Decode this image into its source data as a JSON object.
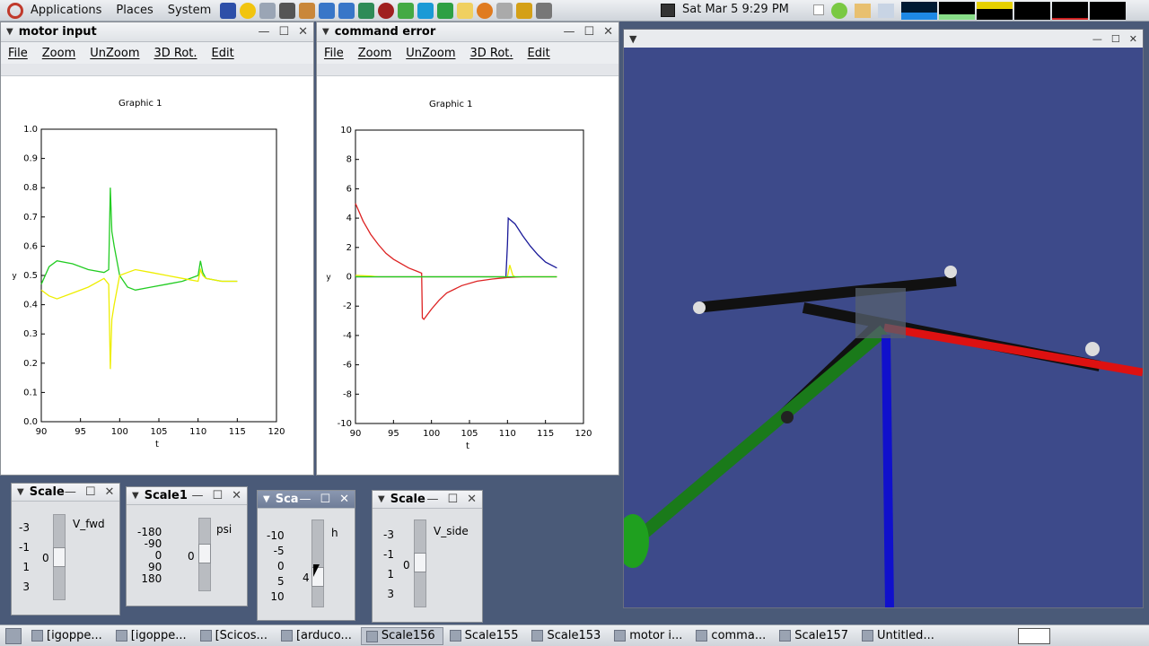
{
  "top_panel": {
    "menus": [
      "Applications",
      "Places",
      "System"
    ],
    "clock": "Sat Mar  5  9:29 PM"
  },
  "windows": {
    "motor_input": {
      "title": "motor input",
      "menu": [
        "File",
        "Zoom",
        "UnZoom",
        "3D Rot.",
        "Edit"
      ],
      "graphic_title": "Graphic 1"
    },
    "command_error": {
      "title": "command error",
      "menu": [
        "File",
        "Zoom",
        "UnZoom",
        "3D Rot.",
        "Edit"
      ],
      "graphic_title": "Graphic 1"
    }
  },
  "chart_data": [
    {
      "type": "line",
      "title": "Graphic 1",
      "xlabel": "t",
      "ylabel": "y",
      "xlim": [
        90,
        120
      ],
      "ylim": [
        0.0,
        1.0
      ],
      "xticks": [
        "90",
        "95",
        "100",
        "105",
        "110",
        "115",
        "120"
      ],
      "yticks": [
        "0.0",
        "0.1",
        "0.2",
        "0.3",
        "0.4",
        "0.5",
        "0.6",
        "0.7",
        "0.8",
        "0.9",
        "1.0"
      ],
      "series": [
        {
          "color": "#22cc22",
          "x": [
            90,
            91,
            92,
            94,
            96,
            98,
            98.6,
            98.8,
            99,
            99.3,
            100,
            101,
            102,
            104,
            106,
            108,
            110,
            110.3,
            110.6,
            111,
            113,
            115
          ],
          "y": [
            0.47,
            0.53,
            0.55,
            0.54,
            0.52,
            0.51,
            0.52,
            0.8,
            0.65,
            0.6,
            0.5,
            0.46,
            0.45,
            0.46,
            0.47,
            0.48,
            0.5,
            0.55,
            0.51,
            0.49,
            0.48,
            0.48
          ]
        },
        {
          "color": "#eeee00",
          "x": [
            90,
            91,
            92,
            94,
            96,
            98,
            98.6,
            98.8,
            99,
            99.3,
            100,
            101,
            102,
            104,
            106,
            108,
            110,
            110.3,
            110.6,
            111,
            113,
            115
          ],
          "y": [
            0.45,
            0.43,
            0.42,
            0.44,
            0.46,
            0.49,
            0.47,
            0.18,
            0.35,
            0.4,
            0.5,
            0.51,
            0.52,
            0.51,
            0.5,
            0.49,
            0.48,
            0.52,
            0.5,
            0.49,
            0.48,
            0.48
          ]
        }
      ]
    },
    {
      "type": "line",
      "title": "Graphic 1",
      "xlabel": "t",
      "ylabel": "y",
      "xlim": [
        90,
        120
      ],
      "ylim": [
        -10,
        10
      ],
      "xticks": [
        "90",
        "95",
        "100",
        "105",
        "110",
        "115",
        "120"
      ],
      "yticks": [
        "-10",
        "-8",
        "-6",
        "-4",
        "-2",
        "0",
        "2",
        "4",
        "6",
        "8",
        "10"
      ],
      "series": [
        {
          "color": "#dd2222",
          "x": [
            90,
            91,
            92,
            93,
            94,
            95,
            96,
            97,
            98,
            98.7,
            98.8,
            99,
            100,
            101,
            102,
            104,
            106,
            108,
            110,
            112,
            116.5
          ],
          "y": [
            5,
            3.8,
            2.9,
            2.2,
            1.6,
            1.2,
            0.9,
            0.6,
            0.4,
            0.25,
            -2.8,
            -2.9,
            -2.2,
            -1.6,
            -1.1,
            -0.6,
            -0.3,
            -0.15,
            -0.05,
            0,
            0
          ]
        },
        {
          "color": "#1a1a99",
          "x": [
            90,
            109.8,
            110,
            110.1,
            111,
            112,
            113,
            114,
            115,
            116.5
          ],
          "y": [
            0,
            0,
            2.2,
            4.0,
            3.6,
            2.8,
            2.1,
            1.5,
            1.0,
            0.6
          ]
        },
        {
          "color": "#eeee00",
          "x": [
            90,
            92,
            93,
            110,
            110.3,
            110.7,
            111,
            116.5
          ],
          "y": [
            0.1,
            0.05,
            0,
            0,
            0.8,
            0.1,
            0,
            0
          ]
        },
        {
          "color": "#22cc22",
          "x": [
            90,
            110,
            111,
            116.5
          ],
          "y": [
            0,
            0,
            0,
            0
          ]
        }
      ]
    }
  ],
  "scales": [
    {
      "title": "Scale",
      "ticks": [
        "-3",
        "-1",
        "1",
        "3"
      ],
      "value": "0",
      "label": "V_fwd"
    },
    {
      "title": "Scale1",
      "ticks": [
        "-180",
        "-90",
        "0",
        "90",
        "180"
      ],
      "value": "0",
      "label": "psi"
    },
    {
      "title": "Sca",
      "ticks": [
        "-10",
        "-5",
        "0",
        "5",
        "10"
      ],
      "value": "4",
      "label": "h"
    },
    {
      "title": "Scale",
      "ticks": [
        "-3",
        "-1",
        "1",
        "3"
      ],
      "value": "0",
      "label": "V_side"
    }
  ],
  "taskbar": {
    "tasks": [
      "[igoppe...",
      "[igoppe...",
      "[Scicos...",
      "[arduco...",
      "Scale156",
      "Scale155",
      "Scale153",
      "motor i...",
      "comma...",
      "Scale157",
      "Untitled..."
    ],
    "active": "Scale156"
  },
  "colors": {
    "plot_green": "#22cc22",
    "plot_yellow": "#eeee00",
    "plot_red": "#dd2222",
    "plot_blue": "#1a1a99",
    "view_bg": "#3d4a8a"
  }
}
